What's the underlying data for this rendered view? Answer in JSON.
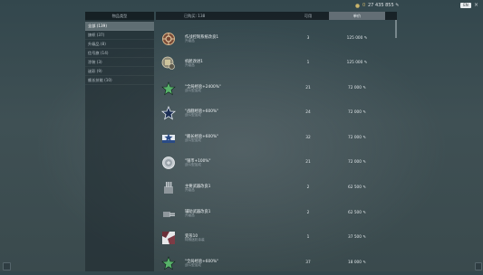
{
  "topbar": {
    "currency_value": "0",
    "credits_value": "27 435 855",
    "credits_symbol": "✎",
    "badge": "EN",
    "close_glyph": "×"
  },
  "shop": {
    "category_header": "物品类型",
    "owned_label": "已购买: 138",
    "avail_header": "可用",
    "price_header": "单价",
    "categories": [
      {
        "label": "全部 (139)"
      },
      {
        "label": "旗帜 (37)"
      },
      {
        "label": "升级品 (8)"
      },
      {
        "label": "信号旗 (14)"
      },
      {
        "label": "涂装 (3)"
      },
      {
        "label": "迷彩 (9)"
      },
      {
        "label": "舰长技能 (10)"
      }
    ],
    "items": [
      {
        "name": "作战控制系统改良1",
        "sub": "升级品",
        "qty": "3",
        "price": "125 000 ✎",
        "icon": "upgrade-gear"
      },
      {
        "name": "机舱改进1",
        "sub": "升级品",
        "qty": "1",
        "price": "125 000 ✎",
        "icon": "upgrade-engine"
      },
      {
        "name": "\"全局经验+2400%\"",
        "sub": "战斗型加成",
        "qty": "21",
        "price": "72 000 ✎",
        "icon": "star-green"
      },
      {
        "name": "\"战舰经验+600%\"",
        "sub": "战斗型加成",
        "qty": "24",
        "price": "72 000 ✎",
        "icon": "star-blue"
      },
      {
        "name": "\"舰长经验+600%\"",
        "sub": "战斗型加成",
        "qty": "32",
        "price": "72 000 ✎",
        "icon": "star-white"
      },
      {
        "name": "\"银币+100%\"",
        "sub": "战斗型加成",
        "qty": "21",
        "price": "72 000 ✎",
        "icon": "coin"
      },
      {
        "name": "主要武器改良1",
        "sub": "升级品",
        "qty": "2",
        "price": "62 500 ✎",
        "icon": "turret"
      },
      {
        "name": "辅助武器改良1",
        "sub": "升级品",
        "qty": "2",
        "price": "62 500 ✎",
        "icon": "secondary"
      },
      {
        "name": "变形10",
        "sub": "特殊迷彩涂装",
        "qty": "1",
        "price": "37 500 ✎",
        "icon": "camo"
      },
      {
        "name": "\"全局经验+600%\"",
        "sub": "战斗型加成",
        "qty": "37",
        "price": "18 000 ✎",
        "icon": "star-green-small"
      }
    ]
  },
  "colors": {
    "accent": "#c9b36a",
    "star_green": "#58b36a",
    "star_blue": "#3f7fd0"
  }
}
